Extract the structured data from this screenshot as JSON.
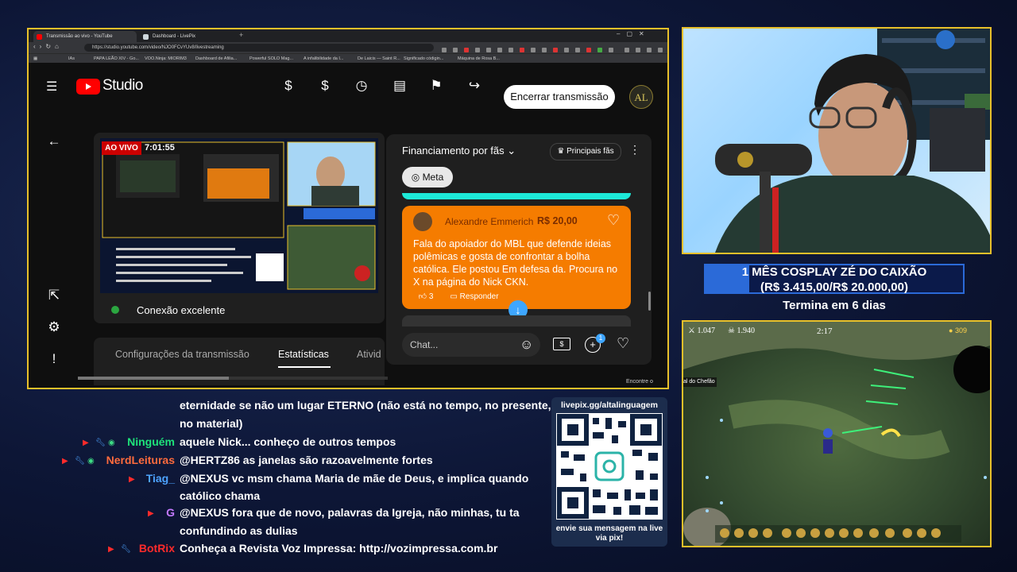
{
  "browser": {
    "tabs": [
      "Transmissão ao vivo - YouTube",
      "Dashboard - LivePix"
    ],
    "url": "https://studio.youtube.com/video/NJO0FCvYUv8/livestreaming",
    "bookmarks": [
      "IAs",
      "PAPA LEÃO XIV - Go...",
      "VOO.Ninja: MIORIM3",
      "Dashboard de Afilia...",
      "Powerful SOLO Mag...",
      "A infalibilidade da I...",
      "De Laicis — Saint R...",
      "Significado códigin...",
      "Máquina de Rosa B..."
    ]
  },
  "studio": {
    "logo_text": "Studio",
    "end_button": "Encerrar transmissão",
    "live_label": "AO VIVO",
    "timer": "7:01:55",
    "connection": "Conexão excelente",
    "tabs": [
      "Configurações da transmissão",
      "Estatísticas",
      "Ativid"
    ],
    "active_tab_index": 1
  },
  "chatpanel": {
    "title": "Financiamento por fãs",
    "top_fans": "Principais fãs",
    "meta_label": "Meta",
    "donation": {
      "name": "Alexandre Emmerich",
      "amount": "R$ 20,00",
      "message": "Fala do apoiador do MBL que defende ideias polêmicas e gosta de confrontar a bolha católica. Ele postou Em defesa da. Procura no X na página do Nick CKN.",
      "likes": "3",
      "reply_label": "Responder"
    },
    "input_placeholder": "Chat...",
    "notif_count": "1"
  },
  "goal": {
    "line1": "1 MÊS COSPLAY ZÉ DO CAIXÃO",
    "line2": "(R$ 3.415,00/R$ 20.000,00)",
    "remaining": "Termina em 6 dias",
    "progress": 0.17
  },
  "game": {
    "stat1": "1.047",
    "stat2": "1.940",
    "clock": "2:17",
    "gold": "309",
    "label": "al do Chefão"
  },
  "overlay_chat": [
    {
      "name": "",
      "name_color": "#ffffff",
      "badges": [],
      "text": "eternidade se não um lugar ETERNO (não está no tempo, no presente,"
    },
    {
      "name": "",
      "name_color": "#ffffff",
      "badges": [],
      "text": "no material)"
    },
    {
      "name": "Ninguém",
      "name_color": "#1ee37a",
      "badges": [
        "yt",
        "wrench",
        "eye"
      ],
      "text": "aquele Nick... conheço de outros tempos"
    },
    {
      "name": "NerdLeituras",
      "name_color": "#ff6b3d",
      "badges": [
        "yt",
        "wrench",
        "eye"
      ],
      "text": "@HERTZ86 as janelas são razoavelmente fortes"
    },
    {
      "name": "Tiag_",
      "name_color": "#4da3ff",
      "badges": [
        "yt"
      ],
      "text": "@NEXUS vc msm chama Maria de mãe de Deus, e implica quando"
    },
    {
      "name": "",
      "name_color": "#ffffff",
      "badges": [],
      "text": "católico chama"
    },
    {
      "name": "G",
      "name_color": "#c47aff",
      "badges": [
        "yt"
      ],
      "text": "@NEXUS fora que de novo, palavras da Igreja, não minhas, tu ta"
    },
    {
      "name": "",
      "name_color": "#ffffff",
      "badges": [],
      "text": "confundindo as dulias"
    },
    {
      "name": "BotRix",
      "name_color": "#ff2b2b",
      "badges": [
        "yt",
        "wrench"
      ],
      "text": "Conheça a Revista Voz Impressa: http://vozimpressa.com.br"
    }
  ],
  "qr": {
    "url": "livepix.gg/altalinguagem",
    "caption": "envie sua mensagem na live via pix!"
  },
  "taskbar_hint": "Encontre o"
}
